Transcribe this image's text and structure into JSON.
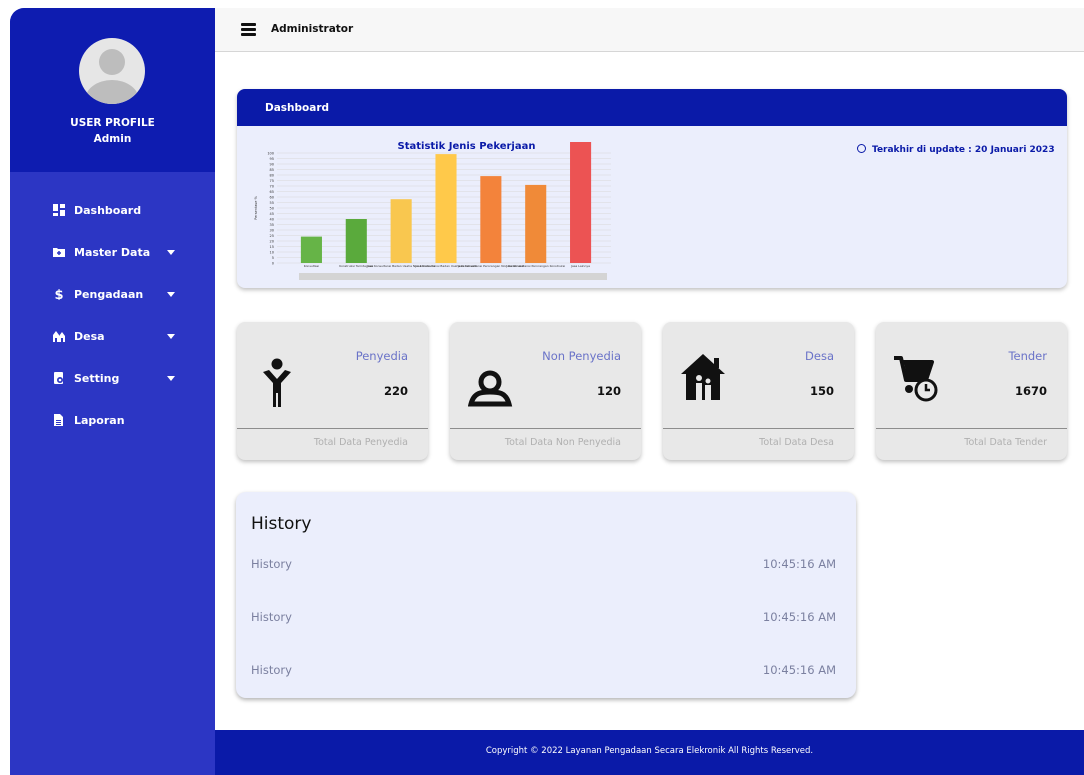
{
  "profile": {
    "title": "USER PROFILE",
    "name": "Admin",
    "avatar_icon": "user-avatar-icon"
  },
  "sidebar": {
    "items": [
      {
        "label": "Dashboard",
        "icon": "dashboard-grid-icon",
        "has_caret": false
      },
      {
        "label": "Master Data",
        "icon": "folder-plus-icon",
        "has_caret": true
      },
      {
        "label": "Pengadaan",
        "icon": "dollar-icon",
        "has_caret": true
      },
      {
        "label": "Desa",
        "icon": "village-icon",
        "has_caret": true
      },
      {
        "label": "Setting",
        "icon": "settings-device-icon",
        "has_caret": true
      },
      {
        "label": "Laporan",
        "icon": "report-file-icon",
        "has_caret": false
      }
    ]
  },
  "topbar": {
    "title": "Administrator",
    "menu_icon": "hamburger-icon"
  },
  "dashboard": {
    "title": "Dashboard",
    "update_text": "Terakhir di update : 20 Januari 2023"
  },
  "chart_data": {
    "type": "bar",
    "title": "Statistik Jenis Pekerjaan",
    "ylabel": "Persentase %",
    "xlabel": "",
    "ylim": [
      0,
      100
    ],
    "yticks": [
      0,
      5,
      10,
      15,
      20,
      25,
      30,
      35,
      40,
      45,
      50,
      55,
      60,
      65,
      70,
      75,
      80,
      85,
      90,
      95,
      100
    ],
    "grid": true,
    "categories": [
      "Konsultasi",
      "Konstruksi Terintegrasi",
      "Jasa Konsultansi Badan Usaha Non Konstruksi",
      "Jasa Konsultansi Badan Usaha Konstruksi",
      "Jasa Konsultansi Perorangan Non Konstruksi",
      "Jasa Konsultansi Perorangan Konstruksi",
      "Jasa Lainnya"
    ],
    "values": [
      24,
      40,
      58,
      99,
      79,
      71,
      110
    ],
    "colors": [
      "#66b447",
      "#5aaa3c",
      "#f9c74f",
      "#ffc94a",
      "#f3833b",
      "#f08a38",
      "#ec5353"
    ]
  },
  "stats": [
    {
      "label": "Penyedia",
      "value": "220",
      "footer": "Total Data Penyedia",
      "icon": "person-icon"
    },
    {
      "label": "Non Penyedia",
      "value": "120",
      "footer": "Total Data Non Penyedia",
      "icon": "users-outline-icon"
    },
    {
      "label": "Desa",
      "value": "150",
      "footer": "Total Data Desa",
      "icon": "house-family-icon"
    },
    {
      "label": "Tender",
      "value": "1670",
      "footer": "Total Data Tender",
      "icon": "cart-clock-icon"
    }
  ],
  "history": {
    "title": "History",
    "items": [
      {
        "label": "History",
        "time": "10:45:16 AM"
      },
      {
        "label": "History",
        "time": "10:45:16 AM"
      },
      {
        "label": "History",
        "time": "10:45:16 AM"
      }
    ]
  },
  "footer": {
    "text": "Copyright © 2022 Layanan Pengadaan Secara Elekronik All Rights Reserved."
  }
}
